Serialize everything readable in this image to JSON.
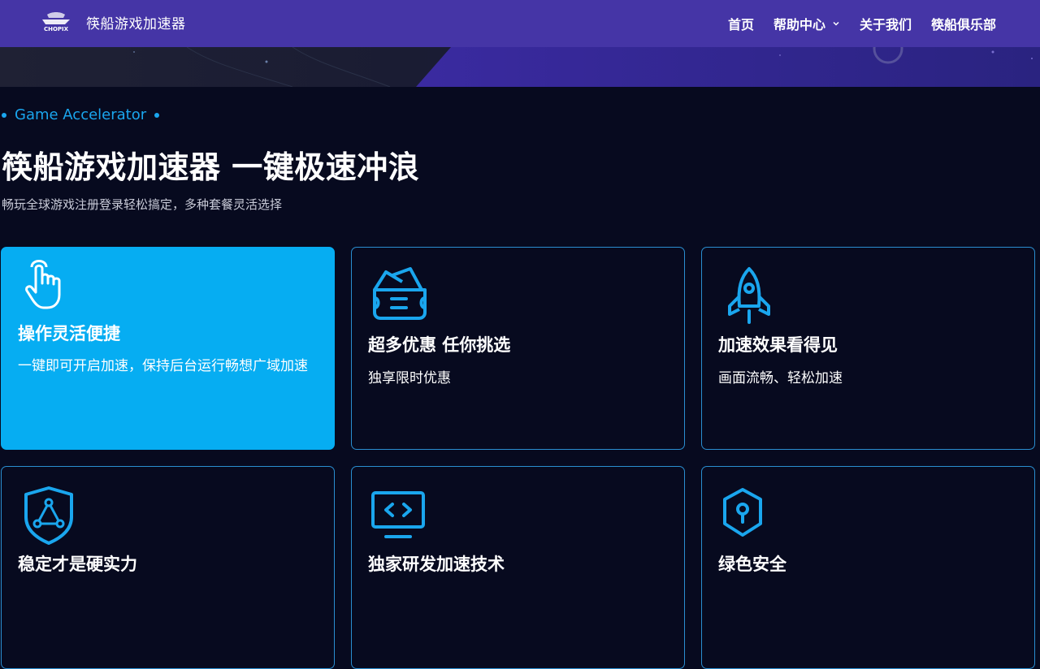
{
  "header": {
    "logo_text": "CHOPIX",
    "brand": "筷船游戏加速器",
    "nav": [
      {
        "label": "首页"
      },
      {
        "label": "帮助中心"
      },
      {
        "label": "关于我们"
      },
      {
        "label": "筷船俱乐部"
      }
    ]
  },
  "hero": {
    "eyebrow": "Game Accelerator",
    "headline": "筷船游戏加速器 一键极速冲浪",
    "subhead": "畅玩全球游戏注册登录轻松搞定，多种套餐灵活选择"
  },
  "features": [
    {
      "title": "操作灵活便捷",
      "desc": "一键即可开启加速，保持后台运行畅想广域加速",
      "icon": "pointer-hand-icon"
    },
    {
      "title": "超多优惠 任你挑选",
      "desc": "独享限时优惠",
      "icon": "wallet-icon"
    },
    {
      "title": "加速效果看得见",
      "desc": "画面流畅、轻松加速",
      "icon": "rocket-icon"
    },
    {
      "title": "稳定才是硬实力",
      "desc": "",
      "icon": "shield-network-icon"
    },
    {
      "title": "独家研发加速技术",
      "desc": "",
      "icon": "code-monitor-icon"
    },
    {
      "title": "绿色安全",
      "desc": "",
      "icon": "shield-lock-icon"
    }
  ],
  "colors": {
    "nav_bg": "#4535a6",
    "page_bg": "#070a1f",
    "accent": "#06adf2",
    "card_border": "#2a8ed0"
  }
}
